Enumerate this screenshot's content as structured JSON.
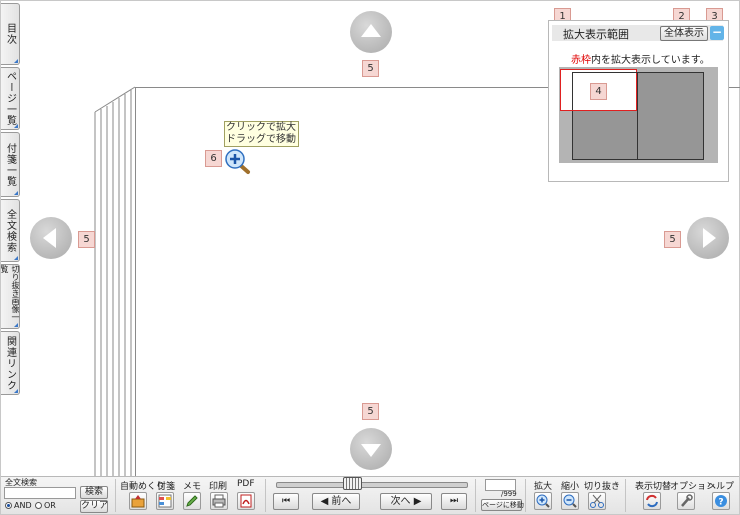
{
  "side_tabs": [
    {
      "label": "目次"
    },
    {
      "label": "ページ一覧"
    },
    {
      "label": "付箋一覧"
    },
    {
      "label": "全文検索"
    },
    {
      "label": "切り抜き画像一覧"
    },
    {
      "label": "関連リンク"
    }
  ],
  "badges": {
    "zoom_panel_title": "1",
    "show_all": "2",
    "close_panel": "3",
    "red_frame": "4",
    "nav_top": "5",
    "nav_left": "5",
    "nav_right": "5",
    "nav_bottom": "5",
    "zoom_cursor": "6"
  },
  "zoom_panel": {
    "title": "拡大表示範囲",
    "show_all_label": "全体表示",
    "close_label": "−",
    "message_red": "赤枠",
    "message_rest": "内を拡大表示しています。"
  },
  "tooltip": {
    "line1": "クリックで拡大",
    "line2": "ドラッグで移動"
  },
  "toolbar": {
    "search": {
      "heading": "全文検索",
      "input_value": "",
      "search_label": "検索",
      "clear_label": "クリア",
      "and_label": "AND",
      "or_label": "OR",
      "selected": "AND"
    },
    "tools": [
      {
        "label": "自動めくり",
        "icon": "auto-flip-icon"
      },
      {
        "label": "付箋",
        "icon": "sticky-note-icon"
      },
      {
        "label": "メモ",
        "icon": "pencil-icon"
      },
      {
        "label": "印刷",
        "icon": "printer-icon"
      },
      {
        "label": "PDF",
        "icon": "pdf-icon"
      }
    ],
    "slider_position": 0.4,
    "nav": {
      "first": "⏮",
      "prev": "◀ 前へ",
      "next": "次へ ▶",
      "last": "⏭"
    },
    "page": {
      "current": "",
      "total": "/999",
      "go_label": "ページに移動"
    },
    "zoom_tools": [
      {
        "label": "拡大",
        "icon": "zoom-in-icon"
      },
      {
        "label": "縮小",
        "icon": "zoom-out-icon"
      },
      {
        "label": "切り抜き",
        "icon": "scissors-icon"
      }
    ],
    "right_tools": [
      {
        "label": "表示切替",
        "icon": "view-switch-icon"
      },
      {
        "label": "オプション",
        "icon": "wrench-icon"
      },
      {
        "label": "ヘルプ",
        "icon": "help-icon"
      }
    ]
  }
}
